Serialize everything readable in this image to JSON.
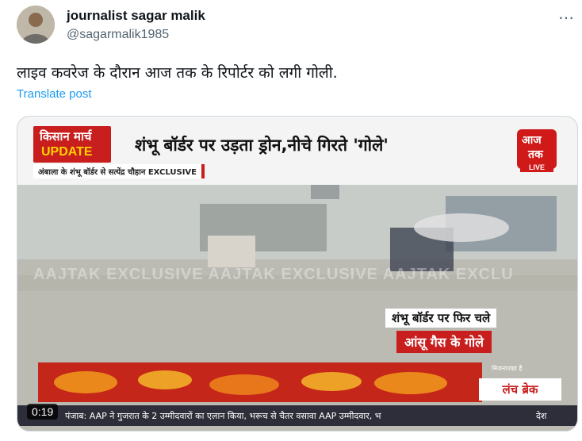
{
  "tweet": {
    "author_name": "journalist sagar malik",
    "handle": "@sagarmalik1985",
    "more_icon": "more-horizontal-icon",
    "text": "लाइव कवरेज के दौरान आज तक के रिपोर्टर को लगी गोली.",
    "translate_label": "Translate post"
  },
  "video": {
    "timestamp": "0:19",
    "badge_line1": "किसान मार्च",
    "badge_line2": "UPDATE",
    "headline": "शंभू बॉर्डर पर उड़ता ड्रोन,नीचे गिरते 'गोले'",
    "sub_tag": "अंबाला के शंभू बॉर्डर से सत्येंद्र चौहान EXCLUSIVE",
    "channel_logo_line1": "आज",
    "channel_logo_line2": "तक",
    "live_label": "LIVE",
    "watermark": "AAJTAK EXCLUSIVE AAJTAK EXCLUSIVE AAJTAK EXCLU",
    "lower_third_line1": "शंभू बॉर्डर पर फिर चले",
    "lower_third_line2": "आंसू गैस के गोले",
    "side_label": "मिजनाजग्रा है",
    "break_label": "लंच ब्रेक",
    "ticker_text": "पंजाब: AAP ने गुजरात के 2 उम्मीदवारों का एलान किया, भरूच से चैतर वसावा AAP उम्मीदवार, भ",
    "ticker_end": "देश"
  },
  "colors": {
    "link": "#1d9bf0",
    "secondary_text": "#536471",
    "channel_red": "#c81e1e"
  }
}
